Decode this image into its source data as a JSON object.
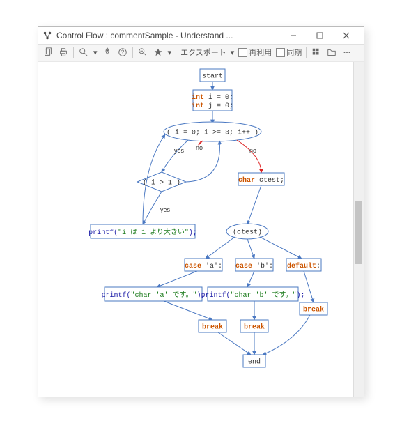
{
  "window": {
    "title": "Control Flow : commentSample - Understand ..."
  },
  "toolbar": {
    "export": "エクスポート",
    "reuse": "再利用",
    "sync": "同期",
    "dropdown_marker": "▾"
  },
  "scroll": {
    "active": true
  },
  "flow": {
    "start": "start",
    "init_line1_kw": "int",
    "init_line1_rest": " i = 0;",
    "init_line2_kw": "int",
    "init_line2_rest": " j = 0;",
    "for_cond": "( i = 0; i >= 3; i++ )",
    "edge_yes": "yes",
    "edge_no": "no",
    "ifcond": "( i > 1 )",
    "printf1_func": "printf(",
    "printf1_str": "\"i は 1 より大きい\"",
    "printf1_end": ");",
    "chardecl_kw": "char",
    "chardecl_rest": " ctest;",
    "switch": "(ctest)",
    "caseA_kw": "case",
    "caseA_rest": " 'a':",
    "caseB_kw": "case",
    "caseB_rest": " 'b':",
    "default_kw": "default",
    "default_rest": ":",
    "printfA_func": "printf(",
    "printfA_str": "\"char 'a' です。\"",
    "printfA_end": ");",
    "printfB_func": "printf(",
    "printfB_str": "\"char 'b' です。\"",
    "printfB_end": ");",
    "break": "break",
    "end": "end"
  }
}
